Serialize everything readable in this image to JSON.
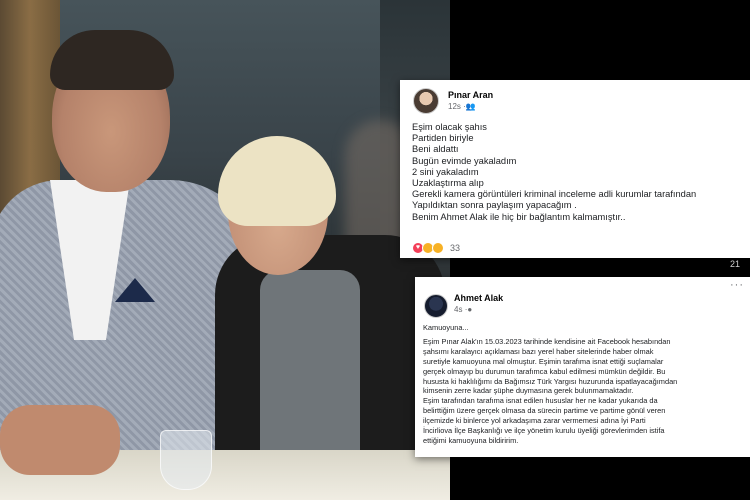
{
  "post1": {
    "author": "Pınar Aran",
    "time": "12s",
    "privacy_icon": "friends-icon",
    "lines": [
      "Eşim olacak şahıs",
      "Partiden biriyle",
      "Beni aldattı",
      "Bugün evimde yakaladım",
      "2 sini yakaladım",
      "Uzaklaştırma alıp",
      "Gerekli kamera görüntüleri kriminal inceleme adli kurumlar tarafından",
      "Yapıldıktan sonra paylaşım yapacağım .",
      "Benim Ahmet Alak ile hiç bir bağlantım kalmamıştır.."
    ],
    "reaction_count": "33",
    "side_count": "21"
  },
  "post2": {
    "author": "Ahmet Alak",
    "time": "4s",
    "lines": [
      "Kamuoyuna...",
      "Eşim Pınar Alak'ın 15.03.2023 tarihinde kendisine ait Facebook hesabından",
      "şahsımı karalayıcı açıklaması bazı yerel haber sitelerinde haber olmak",
      "suretiyle kamuoyuna mal olmuştur. Eşimin tarafıma isnat ettiği suçlamalar",
      "gerçek olmayıp bu durumun tarafımca kabul edilmesi mümkün değildir. Bu",
      "hususta ki haklılığımı da Bağımsız Türk Yargısı huzurunda ispatlayacağımdan",
      "kimsenin zerre kadar şüphe duymasına gerek bulunmamaktadır.",
      "Eşim tarafından tarafıma isnat edilen hususlar her ne kadar yukarıda da",
      "belirttiğim üzere gerçek olmasa da sürecin partime ve partime gönül veren",
      "ilçemizde ki binlerce yol arkadaşıma zarar vermemesi adına  İyi Parti",
      "İncirliova İlçe Başkanlığı ve ilçe yönetim kurulu üyeliği görevlerimden istifa",
      "ettiğimi kamuoyuna bildiririm."
    ]
  }
}
